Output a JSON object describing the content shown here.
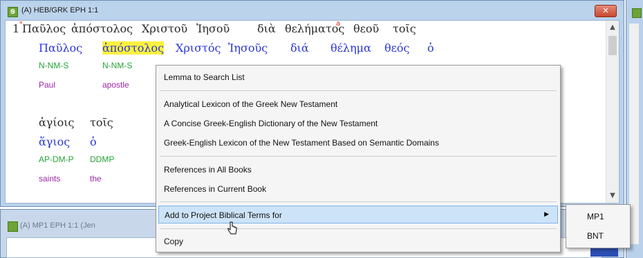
{
  "window": {
    "title": "(A) HEB/GRK EPH 1:1",
    "close_label": "✕"
  },
  "verse": {
    "number": "1",
    "words": [
      "Παῦλος",
      "ἀπόστολος",
      "Χριστοῦ",
      "Ἰησοῦ",
      "διὰ",
      "θελήματος",
      "θεοῦ",
      "τοῖς"
    ],
    "row1": {
      "lemmas": [
        "Παῦλος",
        "ἀπόστολος",
        "Χριστός",
        "Ἰησοῦς",
        "διά",
        "θέλημα",
        "θεός",
        "ὁ"
      ],
      "parsing": [
        "N-NM-S",
        "N-NM-S"
      ],
      "gloss": [
        "Paul",
        "apostle"
      ]
    },
    "row2": {
      "words": [
        "ἁγίοις",
        "τοῖς"
      ],
      "lemmas": [
        "ἅγιος",
        "ὁ"
      ],
      "parsing": [
        "AP-DM-P",
        "DDMP"
      ],
      "gloss": [
        "saints",
        "the"
      ]
    }
  },
  "context_menu": {
    "items": [
      "Lemma to Search List",
      "Analytical Lexicon of the Greek New Testament",
      "A Concise Greek-English Dictionary of the New Testament",
      "Greek-English Lexicon of the New Testament Based on Semantic Domains",
      "References in All Books",
      "References in Current Book",
      "Add to Project Biblical Terms for",
      "Copy"
    ],
    "selected_index": 6,
    "submenu_arrow": "▶"
  },
  "submenu": {
    "items": [
      "MP1",
      "BNT"
    ]
  },
  "bottom_window": {
    "title": "(A) MP1 EPH 1:1 (Jen"
  },
  "colors": {
    "highlight": "#fbf13e",
    "lemma": "#2b35d8",
    "parsing": "#25a33a",
    "gloss": "#9a27a6",
    "selection": "#cde3f8"
  },
  "icons": {
    "window": "paratext-icon",
    "scroll_up": "chevron-up-icon",
    "scroll_down": "chevron-down-icon",
    "submenu": "triangle-right-icon",
    "cursor": "mouse-pointer-icon"
  }
}
